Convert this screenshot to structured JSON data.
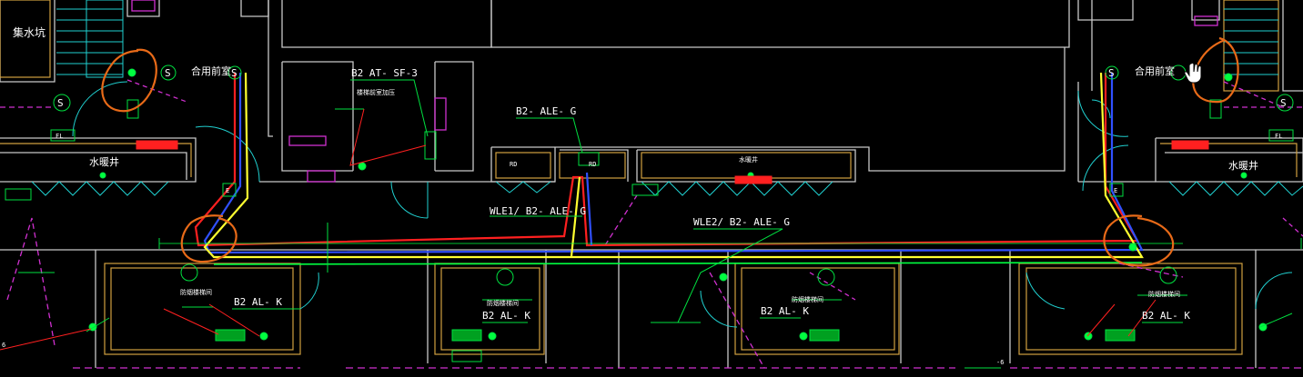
{
  "labels": {
    "sump_pit": "集水坑",
    "shared_anteroom_left": "合用前室",
    "shared_anteroom_right": "合用前室",
    "water_shaft_left": "水暖井",
    "water_shaft_right": "水暖井",
    "water_shaft_center": "水暖井",
    "b2_at_sf_3": "B2 AT- SF-3",
    "b2_at_sf_3_sub": "楼梯前室加压",
    "b2_ale_g": "B2- ALE- G",
    "wle1": "WLE1/ B2- ALE- G",
    "wle2": "WLE2/ B2- ALE- G",
    "b2_al_k_1": "B2 AL- K",
    "b2_al_k_2": "B2 AL- K",
    "b2_al_k_3": "B2 AL- K",
    "b2_al_k_4": "B2 AL- K",
    "room_1": "防烟楼梯间",
    "room_2": "防烟楼梯间",
    "room_3": "防烟楼梯间",
    "room_4": "防烟楼梯间",
    "s_symbol": "S",
    "fl_left": "FL",
    "fl_right": "FL",
    "rd_1": "RD",
    "rd_2": "RD",
    "e_left": "E",
    "e_right": "E",
    "dim_left": "6",
    "dim_right": "-6"
  },
  "colors": {
    "background": "#000000",
    "wall": "#ffffff",
    "wall_gray": "#c8c8c8",
    "cable_red": "#ff2020",
    "cable_blue": "#3050ff",
    "cable_yellow": "#ffff30",
    "cable_green": "#00ff40",
    "leader_green": "#00e040",
    "cyan": "#20d0d0",
    "magenta": "#d030d0",
    "orange_markup": "#e86a18",
    "room_outline": "#d0a040",
    "equipment_red": "#ff2020"
  },
  "icons": {
    "cursor": "hand-pointer-icon",
    "light": "ceiling-light-icon",
    "smoke_detector": "smoke-detector-icon"
  }
}
